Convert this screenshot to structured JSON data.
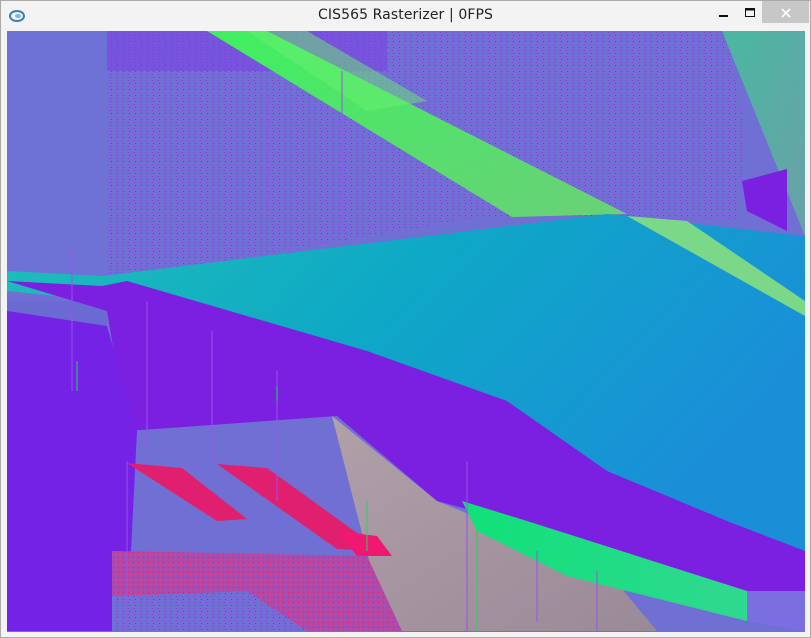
{
  "window": {
    "title": "CIS565 Rasterizer | 0FPS",
    "app_icon": "opengl-app-icon",
    "controls": {
      "minimize_icon": "minimize-icon",
      "maximize_icon": "maximize-icon",
      "close_icon": "close-icon"
    }
  },
  "viewport": {
    "content": "rendered-normals-scene",
    "colors": {
      "background_purple": "#6f6fd4",
      "violet": "#7b1fe0",
      "green": "#5fd66a",
      "teal": "#14a7c4",
      "magenta": "#e0206e",
      "taupe": "#a08a98",
      "mint": "#1ee085"
    }
  }
}
